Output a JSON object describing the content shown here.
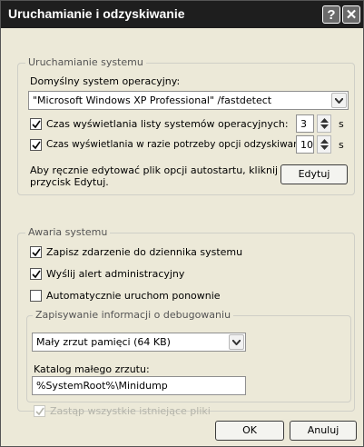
{
  "window": {
    "title": "Uruchamianie i odzyskiwanie",
    "help_glyph": "?",
    "close_glyph": "✕"
  },
  "startup": {
    "legend": "Uruchamianie systemu",
    "default_os_label": "Domyślny system operacyjny:",
    "default_os_value": "\"Microsoft Windows XP Professional\" /fastdetect",
    "show_os_list_label": "Czas wyświetlania listy systemów operacyjnych:",
    "show_os_list_value": "3",
    "show_os_list_checked": true,
    "show_recovery_label": "Czas wyświetlania w razie potrzeby opcji odzyskiwania:",
    "show_recovery_value": "10",
    "show_recovery_checked": true,
    "seconds_unit": "s",
    "edit_hint": "Aby ręcznie edytować plik opcji autostartu, kliknij przycisk Edytuj.",
    "edit_hint_line1": "Aby ręcznie edytować plik opcji autostartu, kliknij",
    "edit_hint_line2": "przycisk Edytuj.",
    "edit_button": "Edytuj"
  },
  "failure": {
    "legend": "Awaria systemu",
    "write_event_label": "Zapisz zdarzenie do dziennika systemu",
    "write_event_checked": true,
    "send_alert_label": "Wyślij alert administracyjny",
    "send_alert_checked": true,
    "auto_restart_label": "Automatycznie uruchom ponownie",
    "auto_restart_checked": false
  },
  "debug": {
    "legend": "Zapisywanie informacji o debugowaniu",
    "dump_type_value": "Mały zrzut pamięci (64 KB)",
    "dump_dir_label": "Katalog małego zrzutu:",
    "dump_dir_value": "%SystemRoot%\\Minidump",
    "overwrite_label": "Zastąp wszystkie istniejące pliki",
    "overwrite_checked": true,
    "overwrite_enabled": false
  },
  "buttons": {
    "ok": "OK",
    "cancel": "Anuluj"
  }
}
